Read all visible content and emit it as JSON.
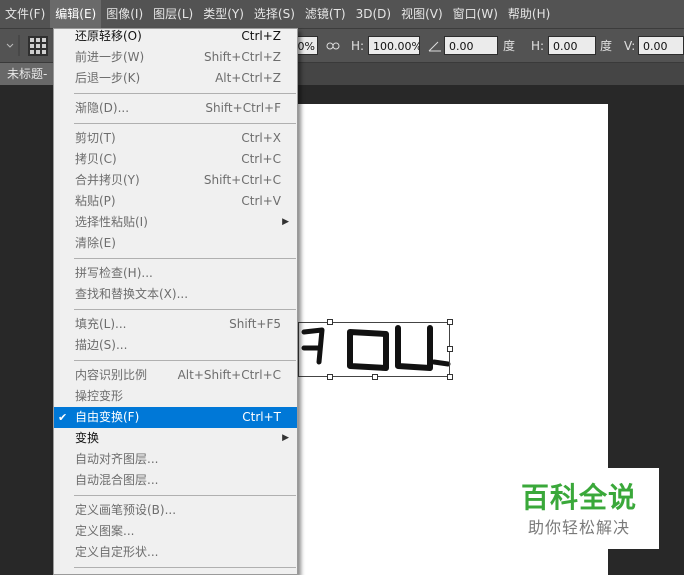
{
  "menubar": {
    "items": [
      "文件(F)",
      "编辑(E)",
      "图像(I)",
      "图层(L)",
      "类型(Y)",
      "选择(S)",
      "滤镜(T)",
      "3D(D)",
      "视图(V)",
      "窗口(W)",
      "帮助(H)"
    ],
    "active_index": 1
  },
  "options": {
    "width_pct": "0%",
    "h_label": "H:",
    "h_value": "100.00%",
    "angle_value": "0.00",
    "degree": "度",
    "hskew_label": "H:",
    "hskew_value": "0.00",
    "degree2": "度",
    "vskew_label": "V:",
    "vskew_value": "0.00"
  },
  "document": {
    "tab_label": "未标题-"
  },
  "edit_menu": {
    "highlight_color": "#0078d7",
    "items": [
      {
        "label": "还原轻移(O)",
        "shortcut": "Ctrl+Z",
        "enabled": true
      },
      {
        "label": "前进一步(W)",
        "shortcut": "Shift+Ctrl+Z",
        "enabled": false
      },
      {
        "label": "后退一步(K)",
        "shortcut": "Alt+Ctrl+Z",
        "enabled": false
      },
      {
        "label": "渐隐(D)...",
        "shortcut": "Shift+Ctrl+F",
        "enabled": false
      },
      {
        "label": "剪切(T)",
        "shortcut": "Ctrl+X",
        "enabled": false
      },
      {
        "label": "拷贝(C)",
        "shortcut": "Ctrl+C",
        "enabled": false
      },
      {
        "label": "合并拷贝(Y)",
        "shortcut": "Shift+Ctrl+C",
        "enabled": false
      },
      {
        "label": "粘贴(P)",
        "shortcut": "Ctrl+V",
        "enabled": false
      },
      {
        "label": "选择性粘贴(I)",
        "shortcut": "",
        "enabled": false,
        "submenu": true
      },
      {
        "label": "清除(E)",
        "shortcut": "",
        "enabled": false
      },
      {
        "label": "拼写检查(H)...",
        "shortcut": "",
        "enabled": false
      },
      {
        "label": "查找和替换文本(X)...",
        "shortcut": "",
        "enabled": false
      },
      {
        "label": "填充(L)...",
        "shortcut": "Shift+F5",
        "enabled": false
      },
      {
        "label": "描边(S)...",
        "shortcut": "",
        "enabled": false
      },
      {
        "label": "内容识别比例",
        "shortcut": "Alt+Shift+Ctrl+C",
        "enabled": false
      },
      {
        "label": "操控变形",
        "shortcut": "",
        "enabled": false
      },
      {
        "label": "自由变换(F)",
        "shortcut": "Ctrl+T",
        "enabled": true,
        "checked": true,
        "highlighted": true
      },
      {
        "label": "变换",
        "shortcut": "",
        "enabled": true,
        "submenu": true
      },
      {
        "label": "自动对齐图层...",
        "shortcut": "",
        "enabled": false
      },
      {
        "label": "自动混合图层...",
        "shortcut": "",
        "enabled": false
      },
      {
        "label": "定义画笔预设(B)...",
        "shortcut": "",
        "enabled": false
      },
      {
        "label": "定义图案...",
        "shortcut": "",
        "enabled": false
      },
      {
        "label": "定义自定形状...",
        "shortcut": "",
        "enabled": false
      }
    ]
  },
  "watermark": {
    "title": "百科全说",
    "subtitle": "助你轻松解决",
    "title_color": "#3aa83a"
  }
}
